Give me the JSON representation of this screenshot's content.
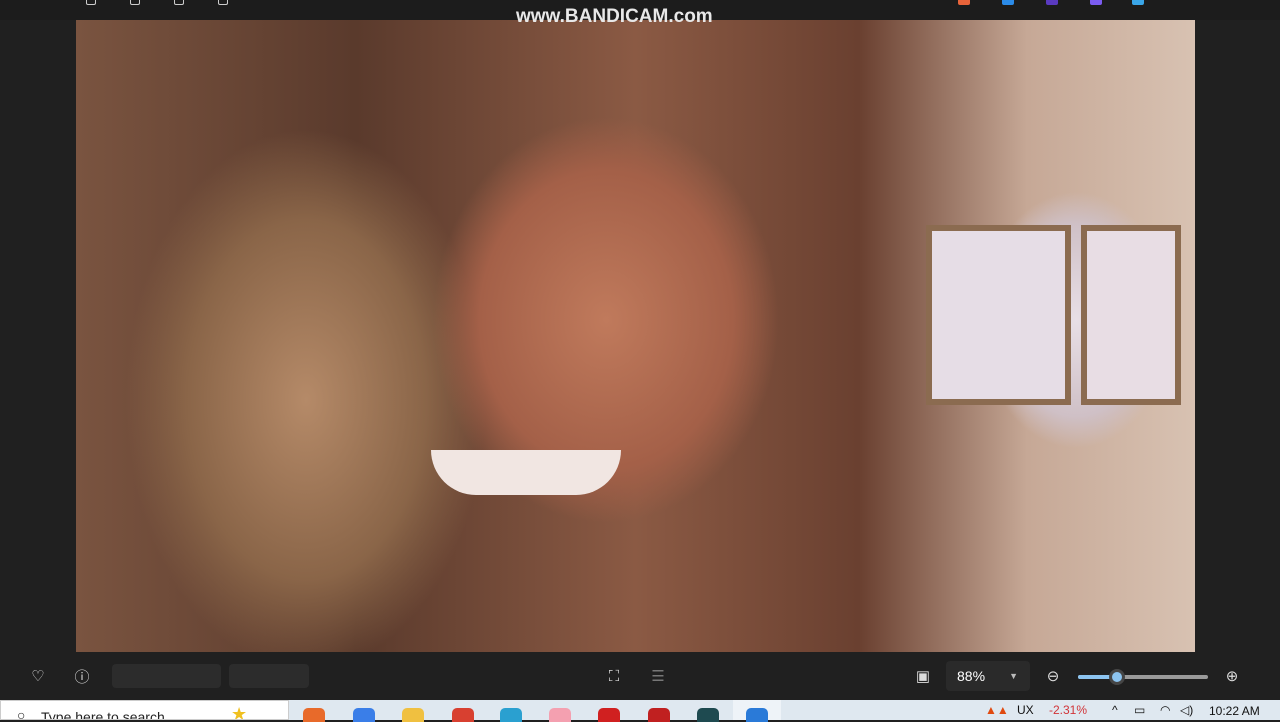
{
  "watermark": "www.BANDICAM.com",
  "toolbar": {
    "zoom_value": "88%",
    "zoom_percent": 30
  },
  "taskbar": {
    "search_placeholder": "Type here to search",
    "stock_symbol": "UX",
    "stock_change": "-2.31%",
    "time": "10:22 AM"
  },
  "colors": {
    "accent": "#8cc4f0",
    "negative": "#d13438"
  }
}
